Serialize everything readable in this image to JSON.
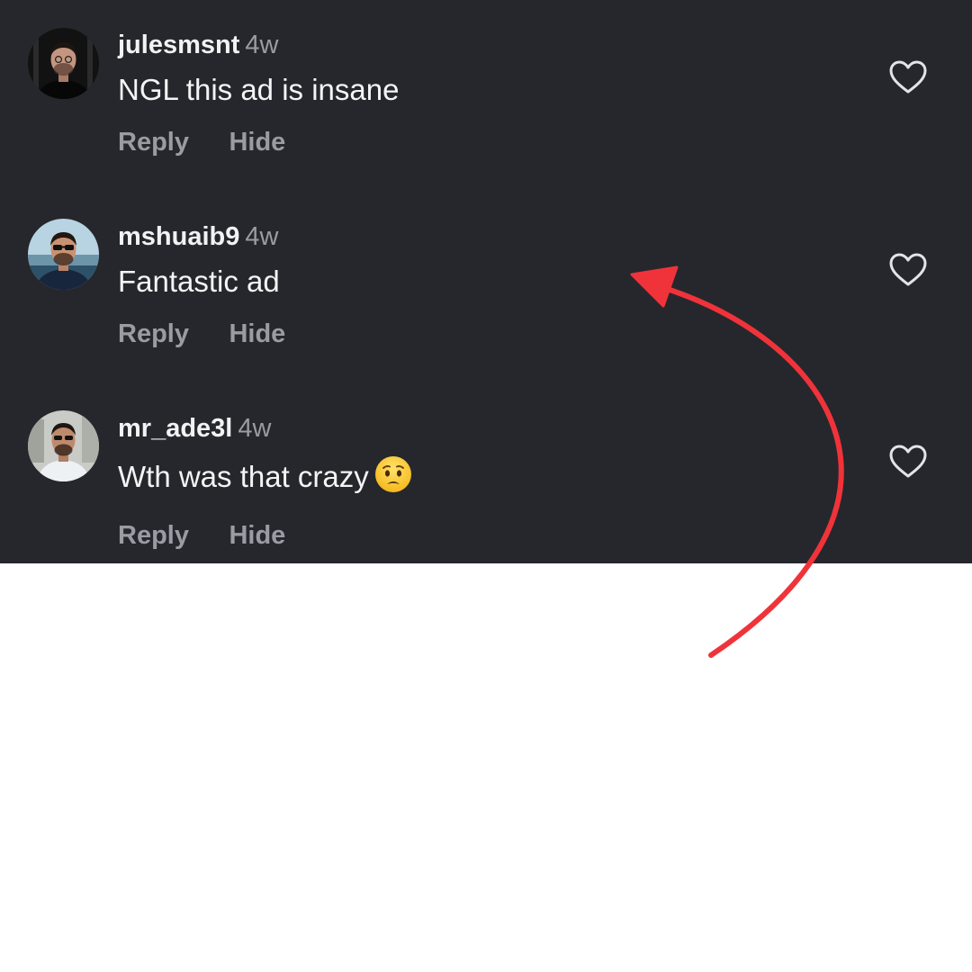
{
  "comments": [
    {
      "username": "julesmsnt",
      "time": "4w",
      "text": "NGL this ad is insane",
      "reply_label": "Reply",
      "hide_label": "Hide"
    },
    {
      "username": "mshuaib9",
      "time": "4w",
      "text": "Fantastic ad",
      "reply_label": "Reply",
      "hide_label": "Hide"
    },
    {
      "username": "mr_ade3l",
      "time": "4w",
      "text": "Wth was that crazy",
      "emoji": "worried-face-emoji",
      "reply_label": "Reply",
      "hide_label": "Hide"
    }
  ],
  "icons": {
    "like": "heart-outline-icon",
    "annotation": "curved-arrow-icon"
  },
  "colors": {
    "panel_background": "#26272c",
    "username": "#f2f2f4",
    "secondary_text": "#9a9ba3",
    "arrow": "#f0333a",
    "page_background": "#ffffff"
  }
}
